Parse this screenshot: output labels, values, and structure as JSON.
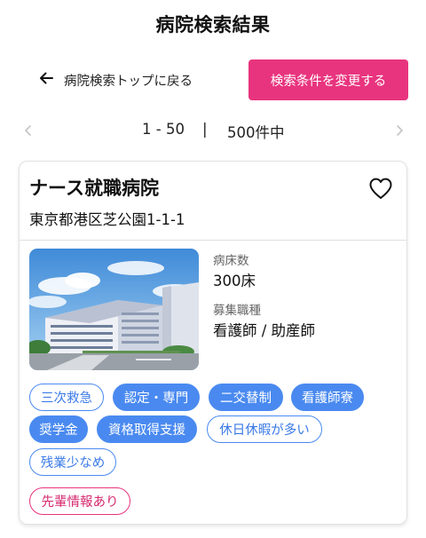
{
  "page": {
    "title": "病院検索結果"
  },
  "nav": {
    "back_label": "病院検索トップに戻る",
    "change_conditions_label": "検索条件を変更する"
  },
  "pagination": {
    "range": "1 - 50",
    "separator": "|",
    "total": "500件中"
  },
  "result": {
    "name": "ナース就職病院",
    "address": "東京都港区芝公園1-1-1",
    "beds_label": "病床数",
    "beds_value": "300床",
    "positions_label": "募集職種",
    "positions_value": "看護師 / 助産師",
    "tags": [
      {
        "label": "三次救急",
        "style": "outline"
      },
      {
        "label": "認定・専門",
        "style": "filled"
      },
      {
        "label": "二交替制",
        "style": "filled"
      },
      {
        "label": "看護師寮",
        "style": "filled"
      },
      {
        "label": "奨学金",
        "style": "filled"
      },
      {
        "label": "資格取得支援",
        "style": "filled"
      },
      {
        "label": "休日休暇が多い",
        "style": "outline"
      },
      {
        "label": "残業少なめ",
        "style": "outline"
      },
      {
        "label": "先輩情報あり",
        "style": "pink"
      }
    ]
  },
  "colors": {
    "accent_pink": "#e8347e",
    "tag_blue": "#4a8af0"
  },
  "icons": {
    "back": "arrow-left-icon",
    "prev": "chevron-left-icon",
    "next": "chevron-right-icon",
    "favorite": "heart-outline-icon"
  }
}
